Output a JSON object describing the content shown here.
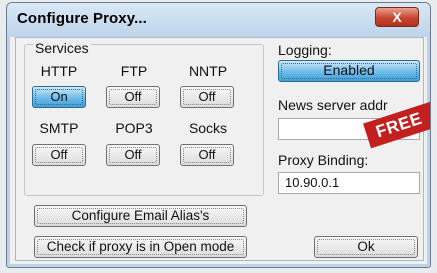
{
  "window": {
    "title": "Configure Proxy...",
    "close_label": "X"
  },
  "services": {
    "legend": "Services",
    "items": [
      {
        "label": "HTTP",
        "state": "On"
      },
      {
        "label": "FTP",
        "state": "Off"
      },
      {
        "label": "NNTP",
        "state": "Off"
      },
      {
        "label": "SMTP",
        "state": "Off"
      },
      {
        "label": "POP3",
        "state": "Off"
      },
      {
        "label": "Socks",
        "state": "Off"
      }
    ]
  },
  "buttons": {
    "configure_alias": "Configure Email Alias's",
    "check_open": "Check if proxy is in Open mode",
    "ok": "Ok"
  },
  "logging": {
    "label": "Logging:",
    "value": "Enabled"
  },
  "news_server": {
    "label": "News server addr",
    "value": ""
  },
  "proxy_binding": {
    "label": "Proxy Binding:",
    "value": "10.90.0.1"
  },
  "banner": {
    "text": "FREE"
  },
  "colors": {
    "accent_on": "#6fbbe9",
    "banner": "#c31f1f",
    "close": "#c6452f"
  }
}
